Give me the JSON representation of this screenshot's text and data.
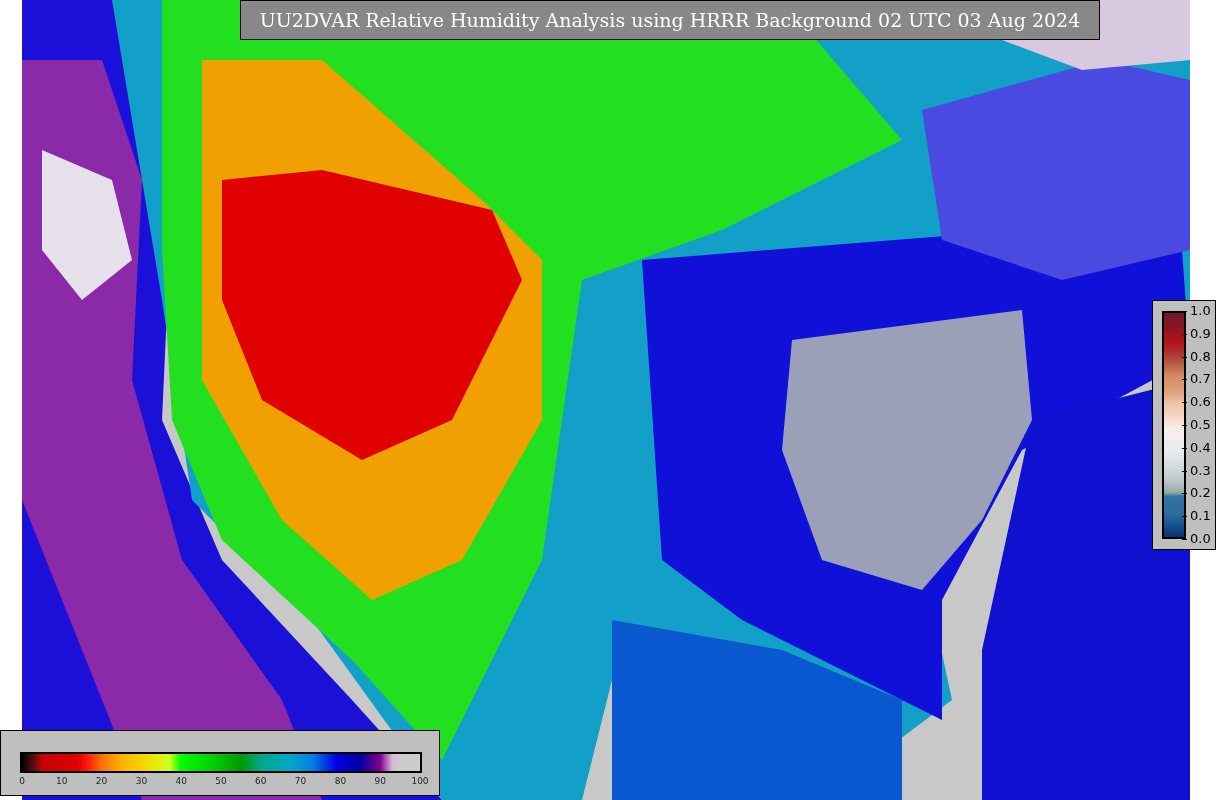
{
  "title": "UU2DVAR Relative Humidity Analysis using HRRR Background 02 UTC 03 Aug 2024",
  "side_colorbar": {
    "ticks": [
      "1.0",
      "0.9",
      "0.8",
      "0.7",
      "0.6",
      "0.5",
      "0.4",
      "0.3",
      "0.2",
      "0.1",
      "0.0"
    ]
  },
  "bottom_colorbar": {
    "ticks": [
      "0",
      "10",
      "20",
      "30",
      "40",
      "50",
      "60",
      "70",
      "80",
      "90",
      "100"
    ]
  }
}
